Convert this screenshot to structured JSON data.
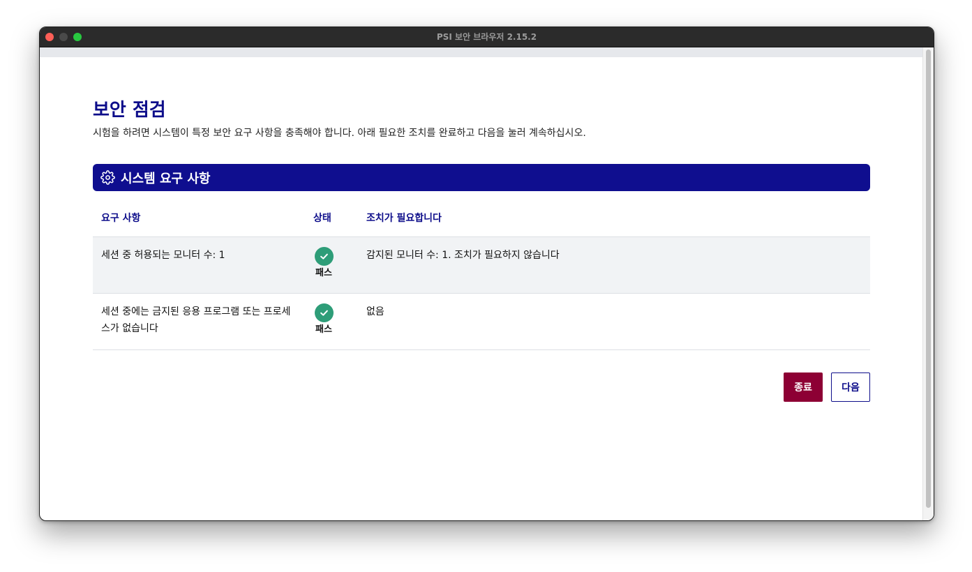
{
  "window": {
    "title": "PSI 보안 브라우저 2.15.2"
  },
  "page": {
    "title": "보안 점검",
    "subtitle": "시험을 하려면 시스템이 특정 보안 요구 사항을 충족해야 합니다. 아래 필요한 조치를 완료하고 다음을 눌러 계속하십시오."
  },
  "section": {
    "title": "시스템 요구 사항",
    "icon": "gear-icon"
  },
  "table": {
    "headers": {
      "requirement": "요구 사항",
      "status": "상태",
      "action": "조치가 필요합니다"
    },
    "rows": [
      {
        "requirement": "세션 중 허용되는 모니터 수: 1",
        "status": "패스",
        "status_icon": "check-circle-icon",
        "action": "감지된 모니터 수: 1. 조치가 필요하지 않습니다"
      },
      {
        "requirement": "세션 중에는 금지된 응용 프로그램 또는 프로세스가 없습니다",
        "status": "패스",
        "status_icon": "check-circle-icon",
        "action": "없음"
      }
    ]
  },
  "buttons": {
    "exit_label": "종료",
    "next_label": "다음"
  },
  "colors": {
    "accent": "#0f0e8f",
    "pass": "#2e9d78",
    "exit_button": "#8d0034"
  }
}
